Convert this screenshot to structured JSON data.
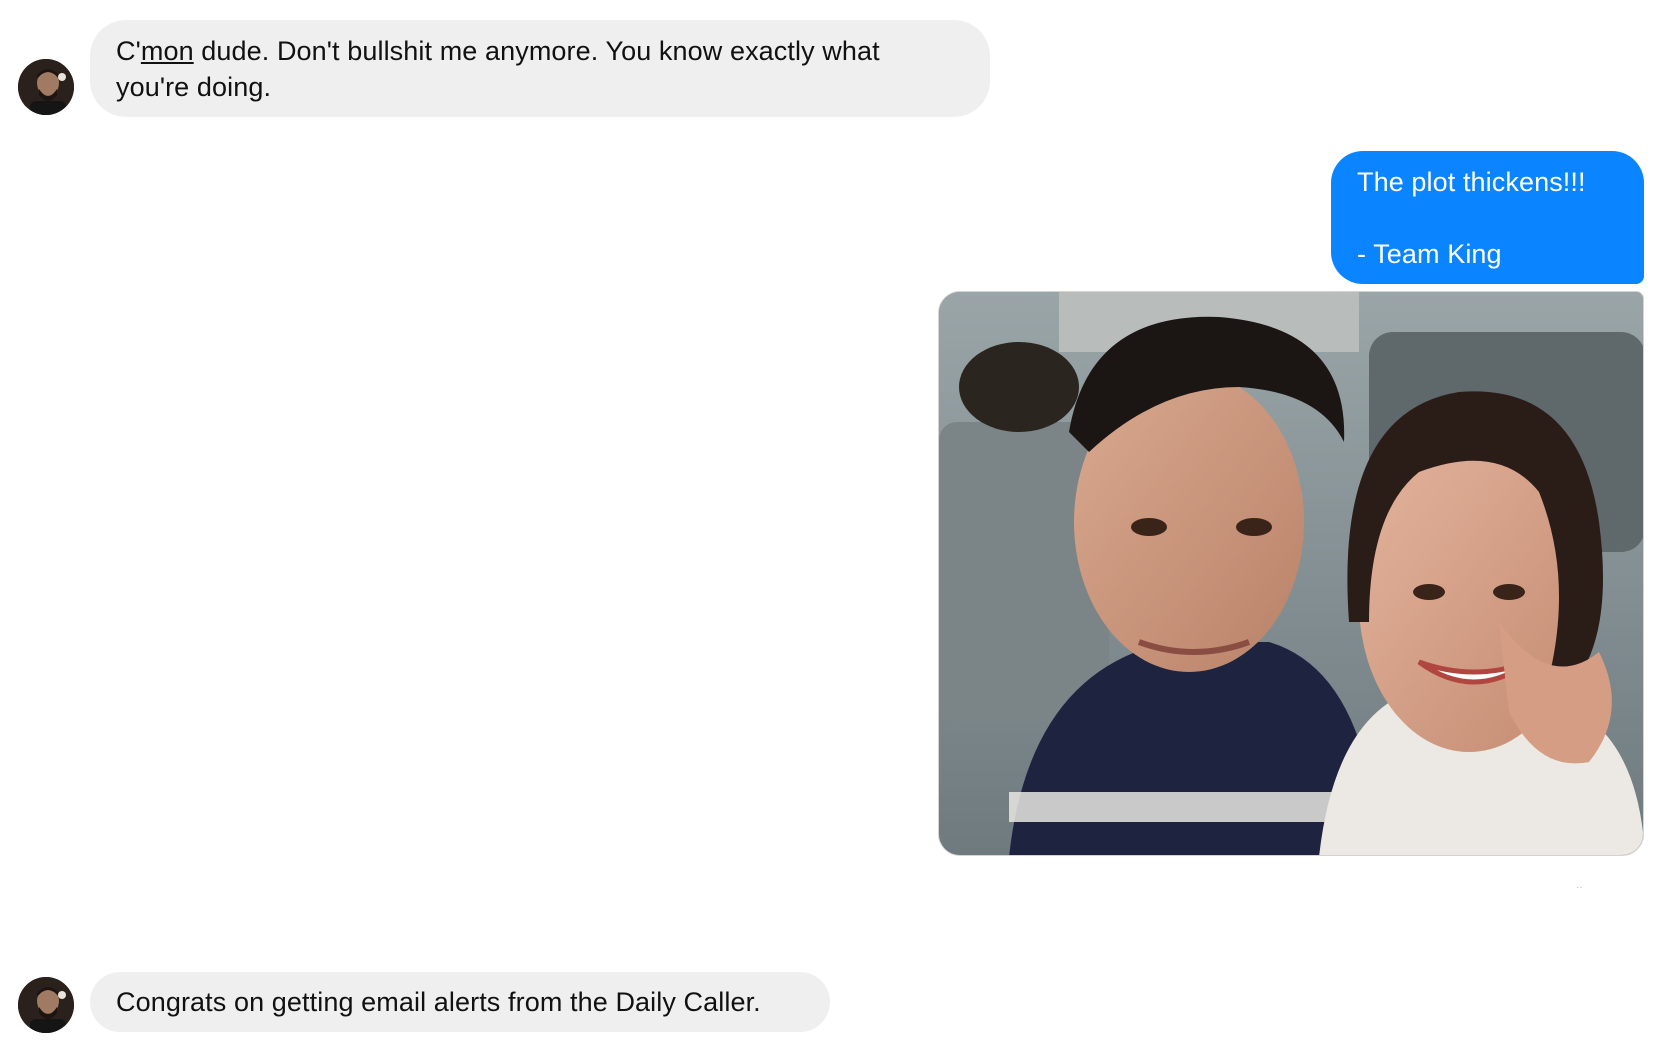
{
  "conversation": {
    "messages": [
      {
        "direction": "incoming",
        "line1_prefix": "C'",
        "line1_link": "mon",
        "line1_suffix": " dude. Don't bullshit me anymore. You know exactly what",
        "line2": "you're doing."
      },
      {
        "direction": "outgoing",
        "line1": "The plot thickens!!!",
        "line2": "- Team King"
      },
      {
        "direction": "outgoing",
        "type": "photo"
      },
      {
        "direction": "incoming",
        "text": "Congrats on getting email alerts from the Daily Caller."
      }
    ]
  },
  "colors": {
    "incoming_bubble": "#f0efef",
    "outgoing_bubble": "#0a84ff"
  },
  "icons": {
    "avatar": "contact-avatar-icon"
  }
}
